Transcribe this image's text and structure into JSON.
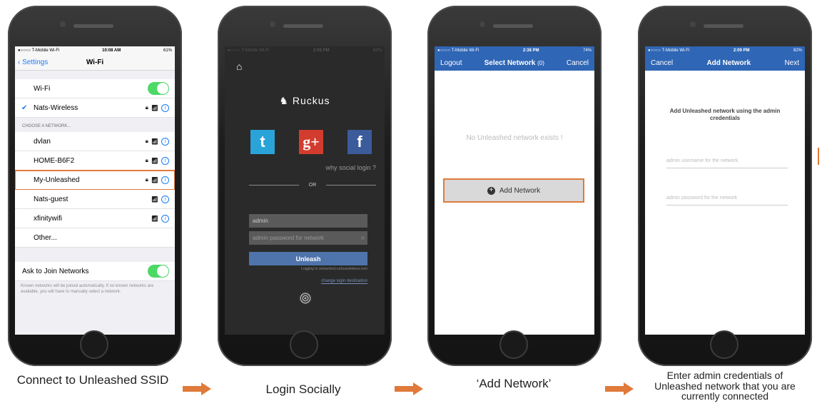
{
  "phone1": {
    "status": {
      "carrier": "●○○○○ T-Mobile Wi-Fi",
      "time": "10:08 AM",
      "battery": "61%"
    },
    "back_label": "Settings",
    "title": "Wi-Fi",
    "wifi_label": "Wi-Fi",
    "connected": "Nats-Wireless",
    "section": "CHOOSE A NETWORK...",
    "networks": [
      "dvlan",
      "HOME-B6F2",
      "My-Unleashed",
      "Nats-guest",
      "xfinitywifi",
      "Other..."
    ],
    "ask_label": "Ask to Join Networks",
    "footnote": "Known networks will be joined automatically. If no known networks are available, you will have to manually select a network."
  },
  "phone2": {
    "status": {
      "carrier": "●○○○○ T-Mobile Wi-Fi",
      "time": "2:09 PM",
      "battery": "82%"
    },
    "logo": "Ruckus",
    "why": "why social login ?",
    "or": "OR",
    "username": "admin",
    "password_placeholder": "admin password for network",
    "button": "Unleash",
    "logging": "Logging to unleashed.ruckuswireless.com",
    "change": "change login destination"
  },
  "phone3": {
    "status": {
      "carrier": "●○○○○ T-Mobile Wi-Fi",
      "time": "2:38 PM",
      "battery": "74%"
    },
    "left": "Logout",
    "title": "Select Network",
    "count": "(0)",
    "right": "Cancel",
    "empty": "No Unleashed network exists !",
    "add": "Add Network"
  },
  "phone4": {
    "status": {
      "carrier": "●○○○○ T-Mobile Wi-Fi",
      "time": "2:09 PM",
      "battery": "82%"
    },
    "left": "Cancel",
    "title": "Add Network",
    "right": "Next",
    "instructions": "Add Unleashed network using the admin credentials",
    "user_placeholder": "admin username for the network",
    "pass_placeholder": "admin password for the network"
  },
  "captions": [
    "Connect to Unleashed SSID",
    "Login Socially",
    "‘Add Network’",
    "Enter admin credentials of Unleashed network that you are currently connected"
  ],
  "colors": {
    "accent_orange": "#e07a3a",
    "ios_blue": "#1a7cf5",
    "app_blue": "#2f66b5",
    "toggle_green": "#4cd964"
  }
}
